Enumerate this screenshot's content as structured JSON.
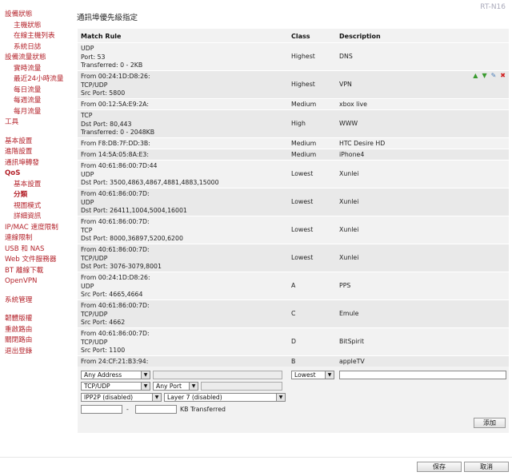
{
  "model": "RT-N16",
  "page_title": "通訊埠優先級指定",
  "sidebar": {
    "items": [
      {
        "label": "設備狀態",
        "level": 0
      },
      {
        "label": "主機狀態",
        "level": 1
      },
      {
        "label": "在線主機列表",
        "level": 1
      },
      {
        "label": "系統日誌",
        "level": 1
      },
      {
        "label": "設備流量狀態",
        "level": 0
      },
      {
        "label": "實時流量",
        "level": 1
      },
      {
        "label": "最近24小時流量",
        "level": 1
      },
      {
        "label": "每日流量",
        "level": 1
      },
      {
        "label": "每週流量",
        "level": 1
      },
      {
        "label": "每月流量",
        "level": 1
      },
      {
        "label": "工具",
        "level": 0
      },
      {
        "gap": true
      },
      {
        "label": "基本設置",
        "level": 0
      },
      {
        "label": "進階設置",
        "level": 0
      },
      {
        "label": "通訊埠轉發",
        "level": 0
      },
      {
        "label": "QoS",
        "level": 0,
        "active": true
      },
      {
        "label": "基本設置",
        "level": 1
      },
      {
        "label": "分類",
        "level": 1,
        "active": true
      },
      {
        "label": "視圖模式",
        "level": 1
      },
      {
        "label": "詳細資訊",
        "level": 1
      },
      {
        "label": "IP/MAC 速度限制",
        "level": 0
      },
      {
        "label": "連線限制",
        "level": 0
      },
      {
        "label": "USB 和 NAS",
        "level": 0
      },
      {
        "label": "Web 文件服務器",
        "level": 0
      },
      {
        "label": "BT 離線下載",
        "level": 0
      },
      {
        "label": "OpenVPN",
        "level": 0
      },
      {
        "gap": true
      },
      {
        "label": "系統管理",
        "level": 0
      },
      {
        "gap": true
      },
      {
        "label": "韌體版權",
        "level": 0
      },
      {
        "label": "重啟路由",
        "level": 0
      },
      {
        "label": "關閉路由",
        "level": 0
      },
      {
        "label": "退出登錄",
        "level": 0
      }
    ]
  },
  "table": {
    "headers": {
      "rule": "Match Rule",
      "class": "Class",
      "desc": "Description"
    },
    "rows": [
      {
        "rule": [
          "UDP",
          "Port: 53",
          "Transferred: 0 - 2KB"
        ],
        "class": "Highest",
        "desc": "DNS"
      },
      {
        "rule": [
          "From 00:24:1D:D8:26:",
          "TCP/UDP",
          "Src Port: 5800"
        ],
        "class": "Highest",
        "desc": "VPN",
        "actions": true
      },
      {
        "rule": [
          "From 00:12:5A:E9:2A:"
        ],
        "class": "Medium",
        "desc": "xbox live"
      },
      {
        "rule": [
          "TCP",
          "Dst Port: 80,443",
          "Transferred: 0 - 2048KB"
        ],
        "class": "High",
        "desc": "WWW"
      },
      {
        "rule": [
          "From F8:DB:7F:DD:3B:"
        ],
        "class": "Medium",
        "desc": "HTC Desire HD"
      },
      {
        "rule": [
          "From 14:5A:05:8A:E3:"
        ],
        "class": "Medium",
        "desc": "iPhone4"
      },
      {
        "rule": [
          "From 40:61:86:00:7D:44",
          "UDP",
          "Dst Port: 3500,4863,4867,4881,4883,15000"
        ],
        "class": "Lowest",
        "desc": "Xunlei"
      },
      {
        "rule": [
          "From 40:61:86:00:7D:",
          "UDP",
          "Dst Port: 26411,1004,5004,16001"
        ],
        "class": "Lowest",
        "desc": "Xunlei"
      },
      {
        "rule": [
          "From 40:61:86:00:7D:",
          "TCP",
          "Dst Port: 8000,36897,5200,6200"
        ],
        "class": "Lowest",
        "desc": "Xunlei"
      },
      {
        "rule": [
          "From 40:61:86:00:7D:",
          "TCP/UDP",
          "Dst Port: 3076-3079,8001"
        ],
        "class": "Lowest",
        "desc": "Xunlei"
      },
      {
        "rule": [
          "From 00:24:1D:D8:26:",
          "UDP",
          "Src Port: 4665,4664"
        ],
        "class": "A",
        "desc": "PPS"
      },
      {
        "rule": [
          "From 40:61:86:00:7D:",
          "TCP/UDP",
          "Src Port: 4662"
        ],
        "class": "C",
        "desc": "Emule"
      },
      {
        "rule": [
          "From 40:61:86:00:7D:",
          "TCP/UDP",
          "Src Port: 1100"
        ],
        "class": "D",
        "desc": "BitSpirit"
      },
      {
        "rule": [
          "From 24:CF:21:B3:94:"
        ],
        "class": "B",
        "desc": "appleTV"
      }
    ],
    "row_actions": {
      "up": "▲",
      "down": "▼",
      "edit": "✎",
      "delete": "✖"
    }
  },
  "form": {
    "address_type": "Any Address",
    "protocol": "TCP/UDP",
    "port_type": "Any Port",
    "ipp2p": "IPP2P (disabled)",
    "layer7": "Layer 7 (disabled)",
    "range_sep": "-",
    "kb_label": "KB Transferred",
    "class": "Lowest",
    "add_button": "添加"
  },
  "footer": {
    "save": "保存",
    "cancel": "取消"
  }
}
